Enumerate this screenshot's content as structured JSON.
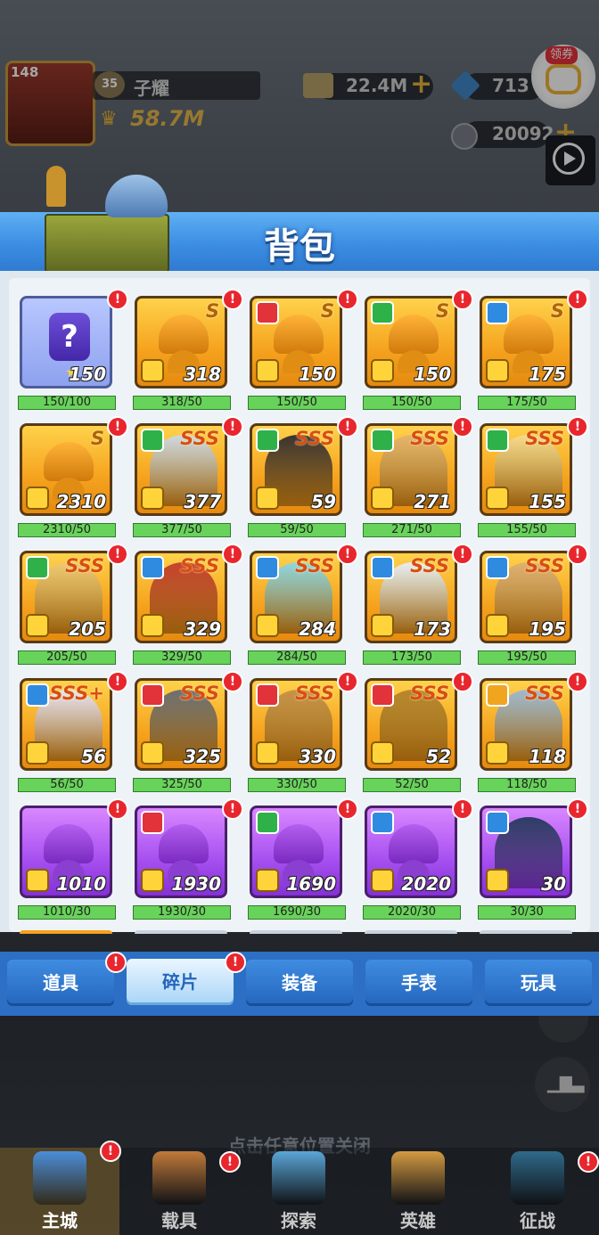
{
  "hud": {
    "level": "148",
    "player_name": "子耀",
    "power": "58.7M",
    "gold": "22.4M",
    "gems": "713",
    "tokens": "20092",
    "coupon_label": "领券",
    "vip_level": "35"
  },
  "panel": {
    "title": "背包"
  },
  "items": [
    {
      "type": "puzzle",
      "count": "150",
      "progress": "150/100",
      "fill": 1.0,
      "alert": "!"
    },
    {
      "type": "gold-helmet",
      "rank": "S",
      "faction": "",
      "count": "318",
      "progress": "318/50",
      "fill": 1.0,
      "alert": "!"
    },
    {
      "type": "gold-helmet",
      "rank": "S",
      "faction": "red",
      "count": "150",
      "progress": "150/50",
      "fill": 1.0,
      "alert": "!"
    },
    {
      "type": "gold-helmet",
      "rank": "S",
      "faction": "green",
      "count": "150",
      "progress": "150/50",
      "fill": 1.0,
      "alert": "!"
    },
    {
      "type": "gold-helmet",
      "rank": "S",
      "faction": "blue",
      "count": "175",
      "progress": "175/50",
      "fill": 1.0,
      "alert": "!"
    },
    {
      "type": "gold-helmet",
      "rank": "S",
      "faction": "",
      "count": "2310",
      "progress": "2310/50",
      "fill": 1.0,
      "alert": "!"
    },
    {
      "type": "hero",
      "rank": "SSS",
      "faction": "green",
      "count": "377",
      "progress": "377/50",
      "fill": 1.0,
      "alert": "!",
      "face": "#cfd8e0"
    },
    {
      "type": "hero",
      "rank": "SSS",
      "faction": "green",
      "count": "59",
      "progress": "59/50",
      "fill": 1.0,
      "alert": "!",
      "face": "#3b3230"
    },
    {
      "type": "hero",
      "rank": "SSS",
      "faction": "green",
      "count": "271",
      "progress": "271/50",
      "fill": 1.0,
      "alert": "!",
      "face": "#e6b46a"
    },
    {
      "type": "hero",
      "rank": "SSS",
      "faction": "green",
      "count": "155",
      "progress": "155/50",
      "fill": 1.0,
      "alert": "!",
      "face": "#f6d98a"
    },
    {
      "type": "hero",
      "rank": "SSS",
      "faction": "green",
      "count": "205",
      "progress": "205/50",
      "fill": 1.0,
      "alert": "!",
      "face": "#f0c870"
    },
    {
      "type": "hero",
      "rank": "SSS",
      "faction": "blue",
      "count": "329",
      "progress": "329/50",
      "fill": 1.0,
      "alert": "!",
      "face": "#c8402c"
    },
    {
      "type": "hero",
      "rank": "SSS",
      "faction": "blue",
      "count": "284",
      "progress": "284/50",
      "fill": 1.0,
      "alert": "!",
      "face": "#8fd6e0"
    },
    {
      "type": "hero",
      "rank": "SSS",
      "faction": "blue",
      "count": "173",
      "progress": "173/50",
      "fill": 1.0,
      "alert": "!",
      "face": "#e8eef2"
    },
    {
      "type": "hero",
      "rank": "SSS",
      "faction": "blue",
      "count": "195",
      "progress": "195/50",
      "fill": 1.0,
      "alert": "!",
      "face": "#e0b070"
    },
    {
      "type": "hero",
      "rank": "SSS+",
      "faction": "blue",
      "count": "56",
      "progress": "56/50",
      "fill": 1.0,
      "alert": "!",
      "face": "#e8e2f4"
    },
    {
      "type": "hero",
      "rank": "SSS",
      "faction": "red",
      "count": "325",
      "progress": "325/50",
      "fill": 1.0,
      "alert": "!",
      "face": "#6e6e72"
    },
    {
      "type": "hero",
      "rank": "SSS",
      "faction": "red",
      "count": "330",
      "progress": "330/50",
      "fill": 1.0,
      "alert": "!",
      "face": "#c89248"
    },
    {
      "type": "hero",
      "rank": "SSS",
      "faction": "red",
      "count": "52",
      "progress": "52/50",
      "fill": 1.0,
      "alert": "!",
      "face": "#b8862c"
    },
    {
      "type": "hero",
      "rank": "SSS",
      "faction": "gold",
      "count": "118",
      "progress": "118/50",
      "fill": 1.0,
      "alert": "!",
      "face": "#9fb8d0"
    },
    {
      "type": "purple-helmet",
      "rank": "",
      "faction": "",
      "count": "1010",
      "progress": "1010/30",
      "fill": 1.0,
      "alert": "!"
    },
    {
      "type": "purple-helmet",
      "rank": "",
      "faction": "red",
      "count": "1930",
      "progress": "1930/30",
      "fill": 1.0,
      "alert": "!"
    },
    {
      "type": "purple-helmet",
      "rank": "",
      "faction": "green",
      "count": "1690",
      "progress": "1690/30",
      "fill": 1.0,
      "alert": "!"
    },
    {
      "type": "purple-helmet",
      "rank": "",
      "faction": "blue",
      "count": "2020",
      "progress": "2020/30",
      "fill": 1.0,
      "alert": "!"
    },
    {
      "type": "hero-purple",
      "rank": "",
      "faction": "blue",
      "count": "30",
      "progress": "30/30",
      "fill": 1.0,
      "alert": "!",
      "face": "#2c3d66"
    }
  ],
  "tabs": [
    {
      "label": "道具",
      "alert": "!",
      "active": false
    },
    {
      "label": "碎片",
      "alert": "!",
      "active": true
    },
    {
      "label": "装备",
      "alert": "",
      "active": false
    },
    {
      "label": "手表",
      "alert": "",
      "active": false
    },
    {
      "label": "玩具",
      "alert": "",
      "active": false
    }
  ],
  "close_hint": "点击任意位置关闭",
  "bottom_nav": [
    {
      "label": "主城",
      "alert": "!",
      "active": true
    },
    {
      "label": "载具",
      "alert": "!",
      "active": false
    },
    {
      "label": "探索",
      "alert": "",
      "active": false
    },
    {
      "label": "英雄",
      "alert": "",
      "active": false
    },
    {
      "label": "征战",
      "alert": "!",
      "active": false
    }
  ],
  "colors": {
    "header_blue": "#3c8ee3",
    "progress_green": "#4bc243",
    "alert_red": "#e8262e",
    "gold_card": "#f5a21e",
    "purple_card": "#a64ff0"
  }
}
